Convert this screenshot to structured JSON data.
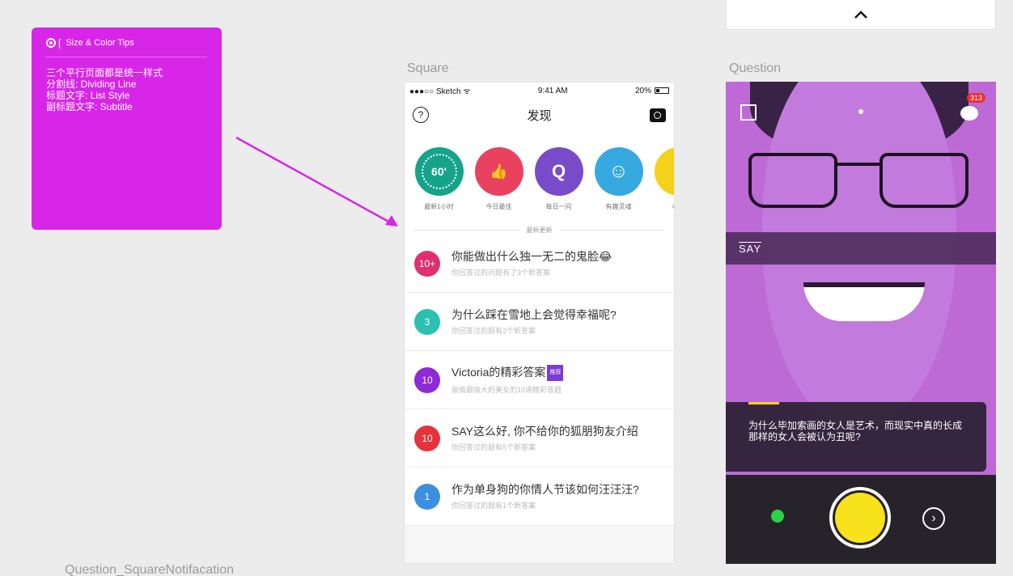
{
  "tip": {
    "title": "Size & Color Tips",
    "bracket": "[",
    "body": "三个平行页面都是统一样式\n分割线: Dividing Line\n标题文字: List Style\n副标题文字: Subtitle"
  },
  "labels": {
    "square": "Square",
    "question": "Question",
    "bottom": "Question_SquareNotifacation"
  },
  "top_panel": {
    "icon": "chevron-up-icon",
    "glyph": "⌃"
  },
  "phone": {
    "carrier": "●●●○○ Sketch",
    "wifi": "ᯤ",
    "time": "9:41 AM",
    "battery": "20%",
    "title": "发现",
    "help_glyph": "?",
    "categories": [
      {
        "label": "最新1小时",
        "text": "60'",
        "color": "#16a38b"
      },
      {
        "label": "今日最佳",
        "text": "👍",
        "color": "#e94260"
      },
      {
        "label": "每日一问",
        "text": "Q",
        "color": "#7a4bc9"
      },
      {
        "label": "有趣灵魂",
        "text": "☺",
        "color": "#35a9e0"
      },
      {
        "label": "本周",
        "text": "⚡",
        "color": "#f4d21b"
      }
    ],
    "section_title": "最新更新",
    "items": [
      {
        "badge": "10+",
        "color": "#e0306f",
        "title": "你能做出什么独一无二的鬼脸😂",
        "sub": "你回答过的问题有了3个新答案",
        "tag": ""
      },
      {
        "badge": "3",
        "color": "#2cc0b0",
        "title": "为什么踩在雪地上会觉得幸福呢?",
        "sub": "你回答过的题有2个新答案",
        "tag": ""
      },
      {
        "badge": "10",
        "color": "#8e2ad6",
        "title": "Victoria的精彩答案",
        "sub": "偷偷跟级大的美女的10道精彩答题",
        "tag": "推荐"
      },
      {
        "badge": "10",
        "color": "#e5333b",
        "title": "SAY这么好, 你不给你的狐朋狗友介绍",
        "sub": "你回答过的题有5个新答案",
        "tag": ""
      },
      {
        "badge": "1",
        "color": "#3b8fe0",
        "title": "作为单身狗的你情人节该如何汪汪汪?",
        "sub": "你回答过的题有1个新答案",
        "tag": ""
      }
    ]
  },
  "question": {
    "notification_count": "313",
    "say_label": "SAY",
    "question_text": "为什么毕加索画的女人是艺术，而现实中真的长成那样的女人会被认为丑呢?",
    "next_glyph": "›"
  }
}
